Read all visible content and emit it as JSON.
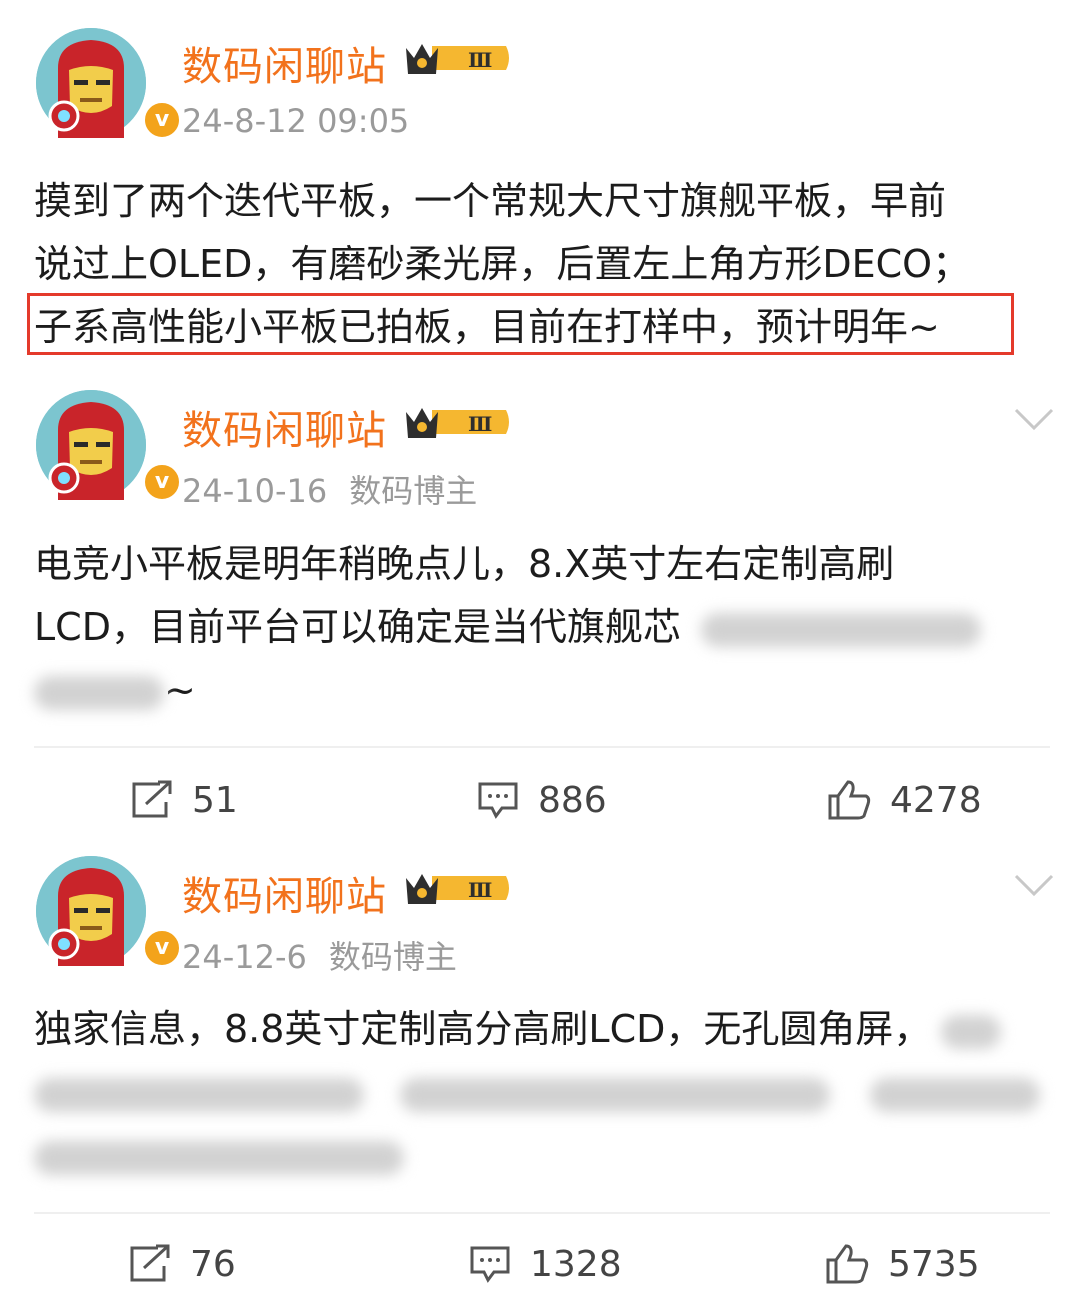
{
  "posts": [
    {
      "username": "数码闲聊站",
      "level": "Ⅲ",
      "time": "24-8-12 09:05",
      "source": "",
      "lines": [
        "摸到了两个迭代平板，一个常规大尺寸旗舰平板，早前",
        "说过上OLED，有磨砂柔光屏，后置左上角方形DECO；",
        "子系高性能小平板已拍板，目前在打样中，预计明年~"
      ]
    },
    {
      "username": "数码闲聊站",
      "level": "Ⅲ",
      "time": "24-10-16",
      "source": "数码博主",
      "lines": [
        "电竞小平板是明年稍晚点儿，8.X英寸左右定制高刷",
        "LCD，目前平台可以确定是当代旗舰芯",
        "~"
      ],
      "stats": {
        "repost": "51",
        "comment": "886",
        "like": "4278"
      }
    },
    {
      "username": "数码闲聊站",
      "level": "Ⅲ",
      "time": "24-12-6",
      "source": "数码博主",
      "lines": [
        "独家信息，8.8英寸定制高分高刷LCD，无孔圆角屏，"
      ],
      "stats": {
        "repost": "76",
        "comment": "1328",
        "like": "5735"
      }
    }
  ],
  "icons": {
    "repost": "repost-icon",
    "comment": "comment-icon",
    "like": "like-icon",
    "verified": "verified-badge-icon",
    "crown": "crown-level-icon",
    "chevron": "chevron-down-icon"
  },
  "colors": {
    "username": "#f2721c",
    "highlight_box": "#e43a2b",
    "meta": "#9a9a9a"
  }
}
